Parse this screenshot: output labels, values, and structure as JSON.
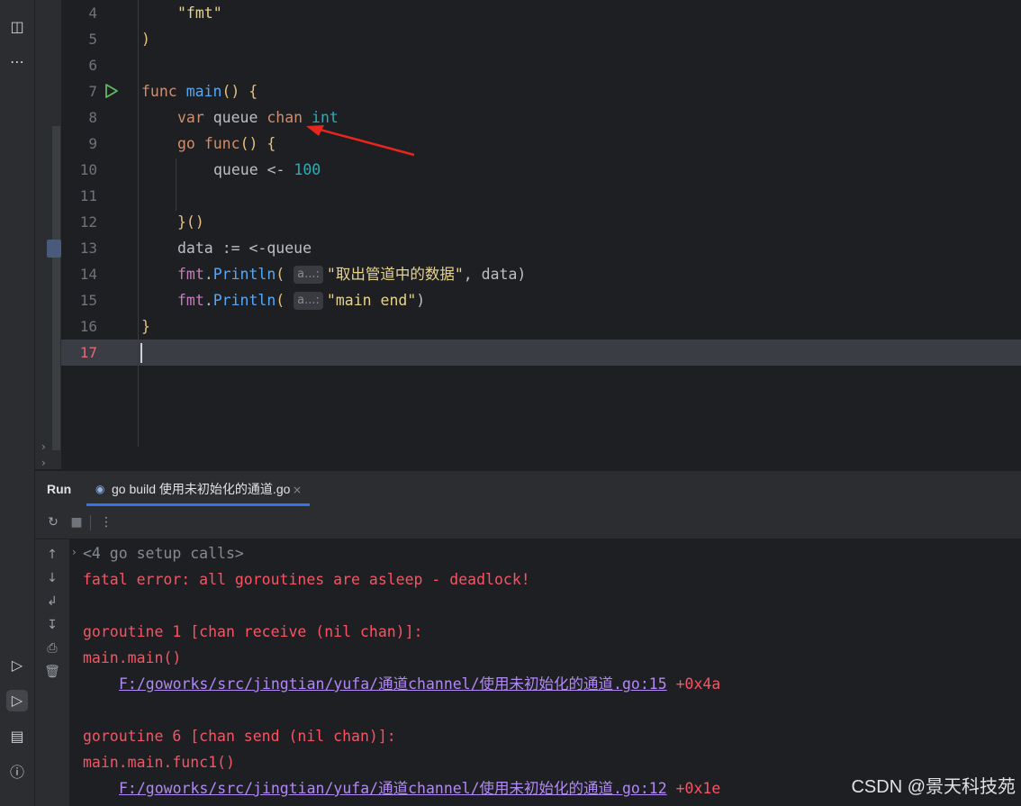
{
  "editor": {
    "line_numbers": [
      "4",
      "5",
      "6",
      "7",
      "8",
      "9",
      "10",
      "11",
      "12",
      "13",
      "14",
      "15",
      "16",
      "17"
    ],
    "current_line": "17",
    "lines": {
      "l4": "\"fmt\"",
      "l5": ")",
      "l7_kw": "func",
      "l7_fn": "main",
      "l7_rest": "() {",
      "l8_kw": "var",
      "l8_id": "queue",
      "l8_chan": "chan",
      "l8_ty": "int",
      "l9_kw": "go",
      "l9_fn": "func",
      "l9_rest": "() {",
      "l10_id": "queue",
      "l10_op": "<-",
      "l10_num": "100",
      "l12": "}()",
      "l13_id": "data",
      "l13_op": ":=",
      "l13_rest": "<-queue",
      "l14_pkg": "fmt",
      "l14_fn": "Println",
      "l14_hint": "a...:",
      "l14_str": "\"取出管道中的数据\"",
      "l14_rest": ", data)",
      "l15_pkg": "fmt",
      "l15_fn": "Println",
      "l15_hint": "a...:",
      "l15_str": "\"main end\"",
      "l15_rest": ")",
      "l16": "}"
    }
  },
  "run_panel": {
    "label": "Run",
    "tab_label": "go build 使用未初始化的通道.go",
    "tab_close": "×"
  },
  "console": {
    "setup_calls": "<4 go setup calls>",
    "fatal": "fatal error: all goroutines are asleep - deadlock!",
    "g1_header": "goroutine 1 [chan receive (nil chan)]:",
    "g1_func": "main.main()",
    "g1_path": "F:/goworks/src/jingtian/yufa/通道channel/使用未初始化的通道.go:15",
    "g1_offset": "+0x4a",
    "g6_header": "goroutine 6 [chan send (nil chan)]:",
    "g6_func": "main.main.func1()",
    "g6_path": "F:/goworks/src/jingtian/yufa/通道channel/使用未初始化的通道.go:12",
    "g6_offset": "+0x1e"
  },
  "watermark": "CSDN @景天科技苑",
  "icons": {
    "activity": [
      "structure-icon",
      "more-icon",
      "services-icon",
      "run-icon",
      "terminal-icon",
      "problems-icon"
    ],
    "toolbar": [
      "rerun-icon",
      "stop-icon",
      "options-icon"
    ],
    "console_side": [
      "scroll-up-icon",
      "scroll-down-icon",
      "soft-wrap-icon",
      "scroll-to-end-icon",
      "print-icon",
      "clear-icon"
    ]
  },
  "colors": {
    "background": "#1e1f22",
    "panel": "#2b2d30",
    "error": "#f75464",
    "link": "#b189f5",
    "annotation_arrow": "#e8261d"
  }
}
